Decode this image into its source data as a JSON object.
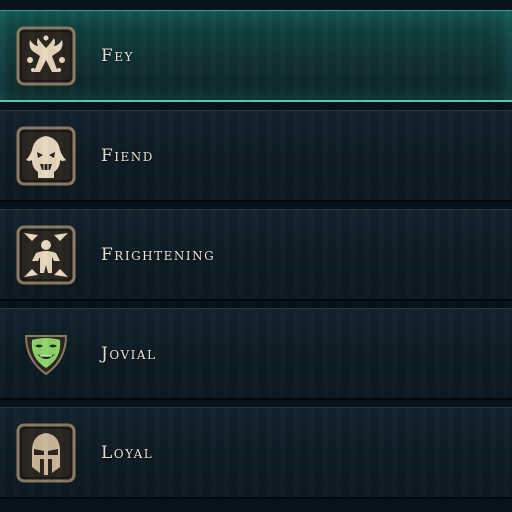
{
  "traits_list": {
    "accent_color": "#5ac7b3",
    "items": [
      {
        "label": "Fey",
        "icon": "fey-antler-icon",
        "selected": true
      },
      {
        "label": "Fiend",
        "icon": "fiend-skull-icon",
        "selected": false
      },
      {
        "label": "Frightening",
        "icon": "frightening-figure-icon",
        "selected": false
      },
      {
        "label": "Jovial",
        "icon": "jovial-mask-icon",
        "selected": false
      },
      {
        "label": "Loyal",
        "icon": "loyal-helmet-icon",
        "selected": false
      }
    ]
  }
}
